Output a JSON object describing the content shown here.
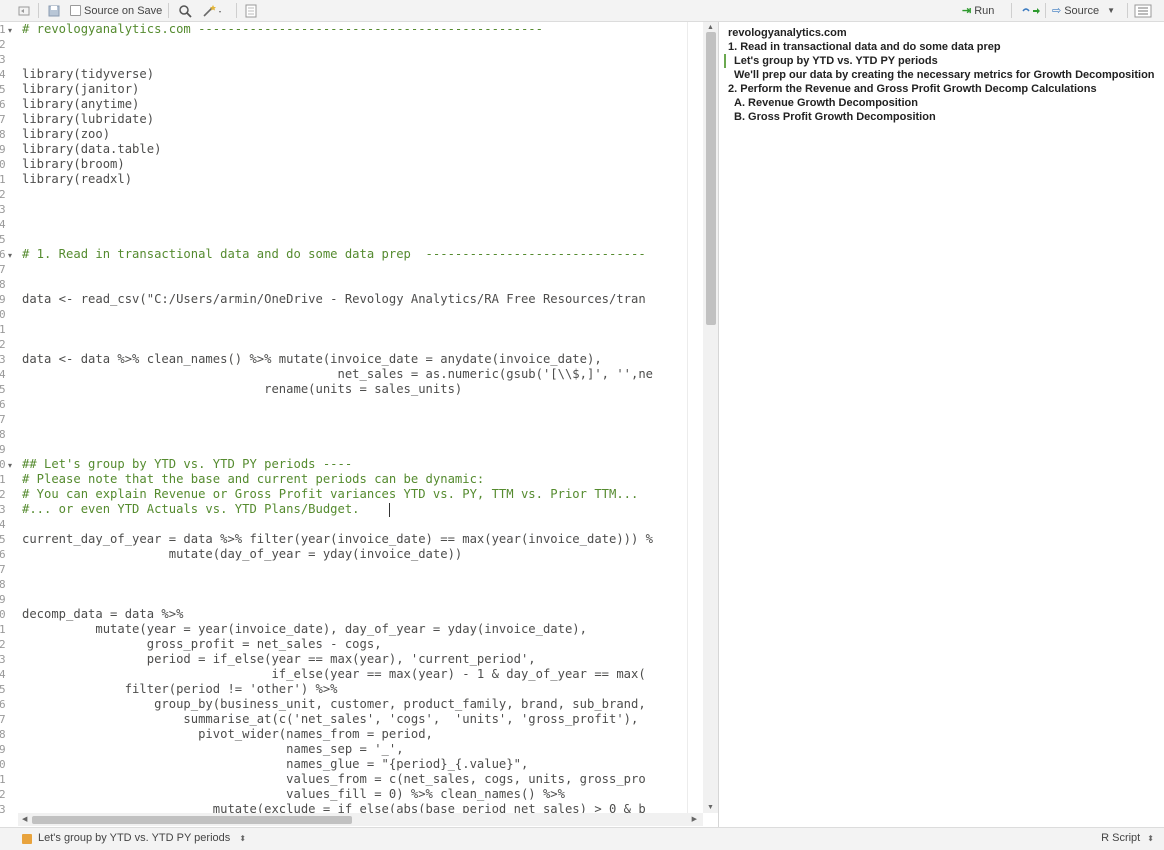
{
  "toolbar": {
    "source_on_save": "Source on Save",
    "run": "Run",
    "source": "Source"
  },
  "editor": {
    "line_numbers": [
      "1",
      "2",
      "3",
      "4",
      "5",
      "6",
      "7",
      "8",
      "9",
      "0",
      "1",
      "2",
      "3",
      "4",
      "5",
      "6",
      "7",
      "8",
      "9",
      "0",
      "1",
      "2",
      "3",
      "4",
      "5",
      "6",
      "7",
      "8",
      "9",
      "0",
      "1",
      "2",
      "3",
      "4",
      "5",
      "6",
      "7",
      "8",
      "9",
      "0",
      "1",
      "2",
      "3",
      "4",
      "5",
      "6",
      "7",
      "8",
      "9",
      "0",
      "1",
      "2",
      "3",
      "4"
    ],
    "lines": [
      {
        "text": "# revologyanalytics.com -----------------------------------------------",
        "type": "comment"
      },
      {
        "text": "",
        "type": "code"
      },
      {
        "text": "",
        "type": "code"
      },
      {
        "text": "library(tidyverse)",
        "type": "code"
      },
      {
        "text": "library(janitor)",
        "type": "code"
      },
      {
        "text": "library(anytime)",
        "type": "code"
      },
      {
        "text": "library(lubridate)",
        "type": "code"
      },
      {
        "text": "library(zoo)",
        "type": "code"
      },
      {
        "text": "library(data.table)",
        "type": "code"
      },
      {
        "text": "library(broom)",
        "type": "code"
      },
      {
        "text": "library(readxl)",
        "type": "code"
      },
      {
        "text": "",
        "type": "code"
      },
      {
        "text": "",
        "type": "code"
      },
      {
        "text": "",
        "type": "code"
      },
      {
        "text": "",
        "type": "code"
      },
      {
        "text": "# 1. Read in transactional data and do some data prep  ------------------------------",
        "type": "comment"
      },
      {
        "text": "",
        "type": "code"
      },
      {
        "text": "",
        "type": "code"
      },
      {
        "text": "data <- read_csv(\"C:/Users/armin/OneDrive - Revology Analytics/RA Free Resources/tran",
        "type": "code"
      },
      {
        "text": "",
        "type": "code"
      },
      {
        "text": "",
        "type": "code"
      },
      {
        "text": "",
        "type": "code"
      },
      {
        "text": "data <- data %>% clean_names() %>% mutate(invoice_date = anydate(invoice_date),",
        "type": "code"
      },
      {
        "text": "                                           net_sales = as.numeric(gsub('[\\\\$,]', '',ne",
        "type": "code"
      },
      {
        "text": "                                 rename(units = sales_units)",
        "type": "code"
      },
      {
        "text": "",
        "type": "code"
      },
      {
        "text": "",
        "type": "code"
      },
      {
        "text": "",
        "type": "code"
      },
      {
        "text": "",
        "type": "code"
      },
      {
        "text": "## Let's group by YTD vs. YTD PY periods ----",
        "type": "comment"
      },
      {
        "text": "# Please note that the base and current periods can be dynamic:",
        "type": "comment"
      },
      {
        "text": "# You can explain Revenue or Gross Profit variances YTD vs. PY, TTM vs. Prior TTM...",
        "type": "comment"
      },
      {
        "text": "#... or even YTD Actuals vs. YTD Plans/Budget.",
        "type": "comment"
      },
      {
        "text": "",
        "type": "code"
      },
      {
        "text": "current_day_of_year = data %>% filter(year(invoice_date) == max(year(invoice_date))) %",
        "type": "code"
      },
      {
        "text": "                    mutate(day_of_year = yday(invoice_date))",
        "type": "code"
      },
      {
        "text": "",
        "type": "code"
      },
      {
        "text": "",
        "type": "code"
      },
      {
        "text": "",
        "type": "code"
      },
      {
        "text": "decomp_data = data %>%",
        "type": "code"
      },
      {
        "text": "          mutate(year = year(invoice_date), day_of_year = yday(invoice_date),",
        "type": "code"
      },
      {
        "text": "                 gross_profit = net_sales - cogs,",
        "type": "code"
      },
      {
        "text": "                 period = if_else(year == max(year), 'current_period',",
        "type": "code"
      },
      {
        "text": "                                  if_else(year == max(year) - 1 & day_of_year == max(",
        "type": "code"
      },
      {
        "text": "              filter(period != 'other') %>%",
        "type": "code"
      },
      {
        "text": "                  group_by(business_unit, customer, product_family, brand, sub_brand,",
        "type": "code"
      },
      {
        "text": "                      summarise_at(c('net_sales', 'cogs',  'units', 'gross_profit'),",
        "type": "code"
      },
      {
        "text": "                        pivot_wider(names_from = period,",
        "type": "code"
      },
      {
        "text": "                                    names_sep = '_',",
        "type": "code"
      },
      {
        "text": "                                    names_glue = \"{period}_{.value}\",",
        "type": "code"
      },
      {
        "text": "                                    values_from = c(net_sales, cogs, units, gross_pro",
        "type": "code"
      },
      {
        "text": "                                    values_fill = 0) %>% clean_names() %>%",
        "type": "code"
      },
      {
        "text": "                          mutate(exclude = if_else(abs(base_period_net_sales) > 0 & b",
        "type": "code"
      }
    ]
  },
  "outline": {
    "items": [
      {
        "label": "revologyanalytics.com",
        "level": 0,
        "active": false
      },
      {
        "label": "1. Read in transactional data and do some data prep",
        "level": 0,
        "active": false
      },
      {
        "label": "Let's group by YTD vs. YTD PY periods",
        "level": 1,
        "active": true
      },
      {
        "label": "We'll prep our data by creating the necessary metrics for Growth Decomposition",
        "level": 1,
        "active": false
      },
      {
        "label": "2. Perform the Revenue and Gross Profit Growth Decomp Calculations",
        "level": 0,
        "active": false
      },
      {
        "label": "A. Revenue Growth Decomposition",
        "level": 1,
        "active": false
      },
      {
        "label": "B. Gross Profit Growth Decomposition",
        "level": 1,
        "active": false
      }
    ]
  },
  "status": {
    "section": "Let's group by YTD vs. YTD PY periods",
    "file_type": "R Script"
  },
  "colors": {
    "comment": "#558b2f",
    "string": "#2e7d32",
    "code": "#4d4d4c",
    "active_marker": "#6aa84f"
  }
}
